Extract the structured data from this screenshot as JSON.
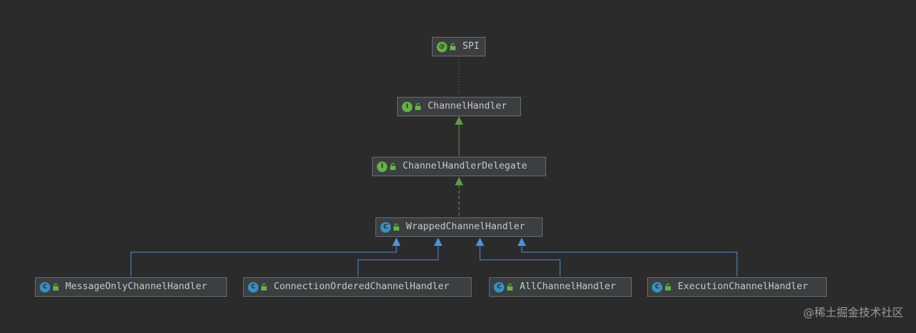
{
  "colors": {
    "background": "#2b2b2b",
    "node_fill": "#3c3f41",
    "node_border": "#6b6b6b",
    "interface_badge": "#62b543",
    "class_badge": "#3592c4",
    "interface_edge": "#5b9c46",
    "class_edge": "#4f8fe0"
  },
  "nodes": {
    "spi": {
      "label": "SPI",
      "kind_letter": "@",
      "kind": "annotation"
    },
    "channel_handler": {
      "label": "ChannelHandler",
      "kind_letter": "I",
      "kind": "interface"
    },
    "channel_handler_delegate": {
      "label": "ChannelHandlerDelegate",
      "kind_letter": "I",
      "kind": "interface"
    },
    "wrapped_channel_handler": {
      "label": "WrappedChannelHandler",
      "kind_letter": "C",
      "kind": "class"
    },
    "message_only_channel_handler": {
      "label": "MessageOnlyChannelHandler",
      "kind_letter": "C",
      "kind": "class"
    },
    "connection_ordered_channel_handler": {
      "label": "ConnectionOrderedChannelHandler",
      "kind_letter": "C",
      "kind": "class"
    },
    "all_channel_handler": {
      "label": "AllChannelHandler",
      "kind_letter": "C",
      "kind": "class"
    },
    "execution_channel_handler": {
      "label": "ExecutionChannelHandler",
      "kind_letter": "C",
      "kind": "class"
    }
  },
  "edges": [
    {
      "from": "channel_handler",
      "to": "spi",
      "type": "annotated-by"
    },
    {
      "from": "channel_handler_delegate",
      "to": "channel_handler",
      "type": "extends"
    },
    {
      "from": "wrapped_channel_handler",
      "to": "channel_handler_delegate",
      "type": "implements"
    },
    {
      "from": "message_only_channel_handler",
      "to": "wrapped_channel_handler",
      "type": "extends"
    },
    {
      "from": "connection_ordered_channel_handler",
      "to": "wrapped_channel_handler",
      "type": "extends"
    },
    {
      "from": "all_channel_handler",
      "to": "wrapped_channel_handler",
      "type": "extends"
    },
    {
      "from": "execution_channel_handler",
      "to": "wrapped_channel_handler",
      "type": "extends"
    }
  ],
  "watermark": "@稀土掘金技术社区"
}
